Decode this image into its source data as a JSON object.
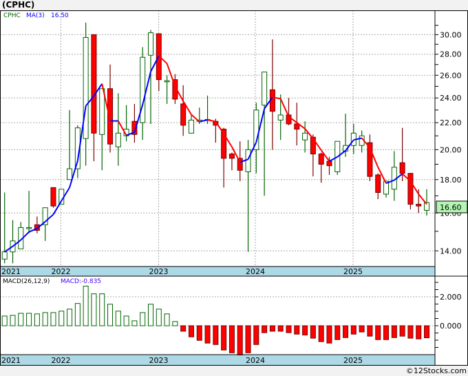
{
  "title": "(CPHC)",
  "footer": "©12Stocks.com",
  "legend": {
    "symbol": "CPHC",
    "ma_label": "MA(3)",
    "ma_value": "16.50"
  },
  "macd_legend": {
    "label": "MACD(26,12,9)",
    "value": "MACD:-0.835"
  },
  "last_price_label": "16.60",
  "colors": {
    "up": "#006400",
    "down_fill": "#ff0000",
    "down_edge": "#7a0000",
    "ma_up": "#0000ff",
    "ma_down": "#ff0000",
    "band": "#add8e6",
    "last_price_bg": "#b4f5b4"
  },
  "chart_data": [
    {
      "type": "candlestick",
      "title": "CPHC monthly",
      "scale": "log",
      "ylim": [
        13.3,
        31.5
      ],
      "yticks": [
        "14.00",
        "16.00",
        "18.00",
        "20.00",
        "22.00",
        "24.00",
        "26.00",
        "28.00",
        "30.00"
      ],
      "xticks": [
        "2021",
        "2022",
        "2023",
        "2024",
        "2025"
      ],
      "ohlc": [
        [
          13.6,
          17.2,
          13.4,
          13.95
        ],
        [
          13.95,
          15.6,
          13.4,
          14.5
        ],
        [
          14.1,
          15.5,
          14.1,
          15.2
        ],
        [
          15.2,
          17.3,
          14.9,
          15.2
        ],
        [
          15.35,
          15.8,
          14.9,
          15.05
        ],
        [
          15.35,
          16.3,
          14.5,
          16.3
        ],
        [
          17.5,
          17.5,
          16.3,
          16.4
        ],
        [
          16.5,
          17.4,
          16.5,
          17.4
        ],
        [
          18.0,
          23.0,
          18.0,
          18.7
        ],
        [
          18.7,
          21.8,
          18.1,
          21.6
        ],
        [
          20.8,
          31.3,
          18.9,
          29.7
        ],
        [
          30.0,
          30.0,
          19.2,
          21.2
        ],
        [
          21.1,
          24.8,
          18.6,
          24.8
        ],
        [
          24.8,
          27.0,
          19.8,
          20.4
        ],
        [
          20.2,
          24.4,
          18.9,
          21.2
        ],
        [
          21.0,
          23.4,
          20.6,
          21.5
        ],
        [
          22.1,
          23.5,
          20.5,
          21.1
        ],
        [
          22.0,
          28.7,
          20.7,
          27.7
        ],
        [
          27.9,
          30.5,
          21.9,
          30.2
        ],
        [
          30.1,
          30.1,
          24.6,
          25.6
        ],
        [
          25.45,
          26.0,
          23.5,
          25.5
        ],
        [
          25.6,
          26.1,
          23.5,
          23.9
        ],
        [
          23.5,
          25.1,
          21.0,
          21.8
        ],
        [
          21.2,
          22.6,
          21.2,
          22.2
        ],
        [
          22.1,
          23.2,
          21.9,
          22.2
        ],
        [
          22.2,
          24.2,
          21.9,
          22.25
        ],
        [
          22.1,
          22.3,
          20.5,
          21.8
        ],
        [
          21.5,
          21.6,
          17.5,
          19.4
        ],
        [
          19.7,
          19.8,
          18.6,
          19.4
        ],
        [
          19.4,
          20.6,
          17.9,
          18.6
        ],
        [
          18.5,
          20.7,
          13.95,
          20.0
        ],
        [
          20.0,
          23.6,
          18.4,
          23.0
        ],
        [
          23.4,
          26.3,
          17.0,
          26.3
        ],
        [
          24.7,
          29.5,
          20.0,
          22.9
        ],
        [
          22.2,
          24.3,
          20.7,
          22.6
        ],
        [
          22.6,
          24.0,
          21.8,
          21.9
        ],
        [
          21.9,
          23.6,
          20.3,
          21.5
        ],
        [
          20.7,
          22.1,
          19.8,
          21.2
        ],
        [
          20.9,
          21.1,
          18.2,
          19.7
        ],
        [
          19.7,
          19.8,
          17.8,
          19.0
        ],
        [
          19.2,
          19.5,
          18.3,
          18.9
        ],
        [
          18.5,
          20.6,
          18.3,
          20.6
        ],
        [
          19.9,
          22.7,
          19.5,
          20.3
        ],
        [
          20.3,
          21.9,
          19.7,
          21.2
        ],
        [
          20.3,
          21.4,
          19.8,
          21.0
        ],
        [
          20.5,
          21.1,
          17.9,
          18.2
        ],
        [
          18.3,
          18.4,
          16.8,
          17.2
        ],
        [
          17.1,
          17.9,
          16.9,
          17.9
        ],
        [
          17.4,
          19.9,
          16.7,
          18.8
        ],
        [
          19.1,
          21.6,
          17.9,
          18.4
        ],
        [
          18.4,
          18.4,
          16.2,
          16.5
        ],
        [
          16.5,
          17.4,
          16.0,
          16.4
        ],
        [
          16.15,
          17.4,
          15.85,
          16.6
        ]
      ],
      "ma_period": 3,
      "last_close": 16.6
    },
    {
      "type": "bar",
      "title": "MACD(26,12,9)",
      "ylim": [
        -2.05,
        3.4
      ],
      "yticks": [
        "0.000",
        "2.000"
      ],
      "xticks": [
        "2021",
        "2022",
        "2023",
        "2024",
        "2025"
      ],
      "values": [
        0.67,
        0.72,
        0.86,
        0.86,
        0.82,
        0.91,
        0.91,
        1.01,
        1.15,
        1.54,
        2.74,
        2.21,
        2.21,
        1.49,
        1.01,
        0.67,
        0.34,
        0.91,
        1.49,
        1.15,
        0.82,
        0.29,
        -0.38,
        -0.77,
        -1.01,
        -1.2,
        -1.3,
        -1.68,
        -1.87,
        -2.02,
        -1.87,
        -1.3,
        -0.48,
        -0.38,
        -0.38,
        -0.48,
        -0.58,
        -0.64,
        -0.86,
        -1.1,
        -1.2,
        -0.96,
        -0.82,
        -0.58,
        -0.43,
        -0.72,
        -0.96,
        -0.96,
        -0.82,
        -0.72,
        -0.86,
        -0.91,
        -0.835
      ]
    }
  ]
}
